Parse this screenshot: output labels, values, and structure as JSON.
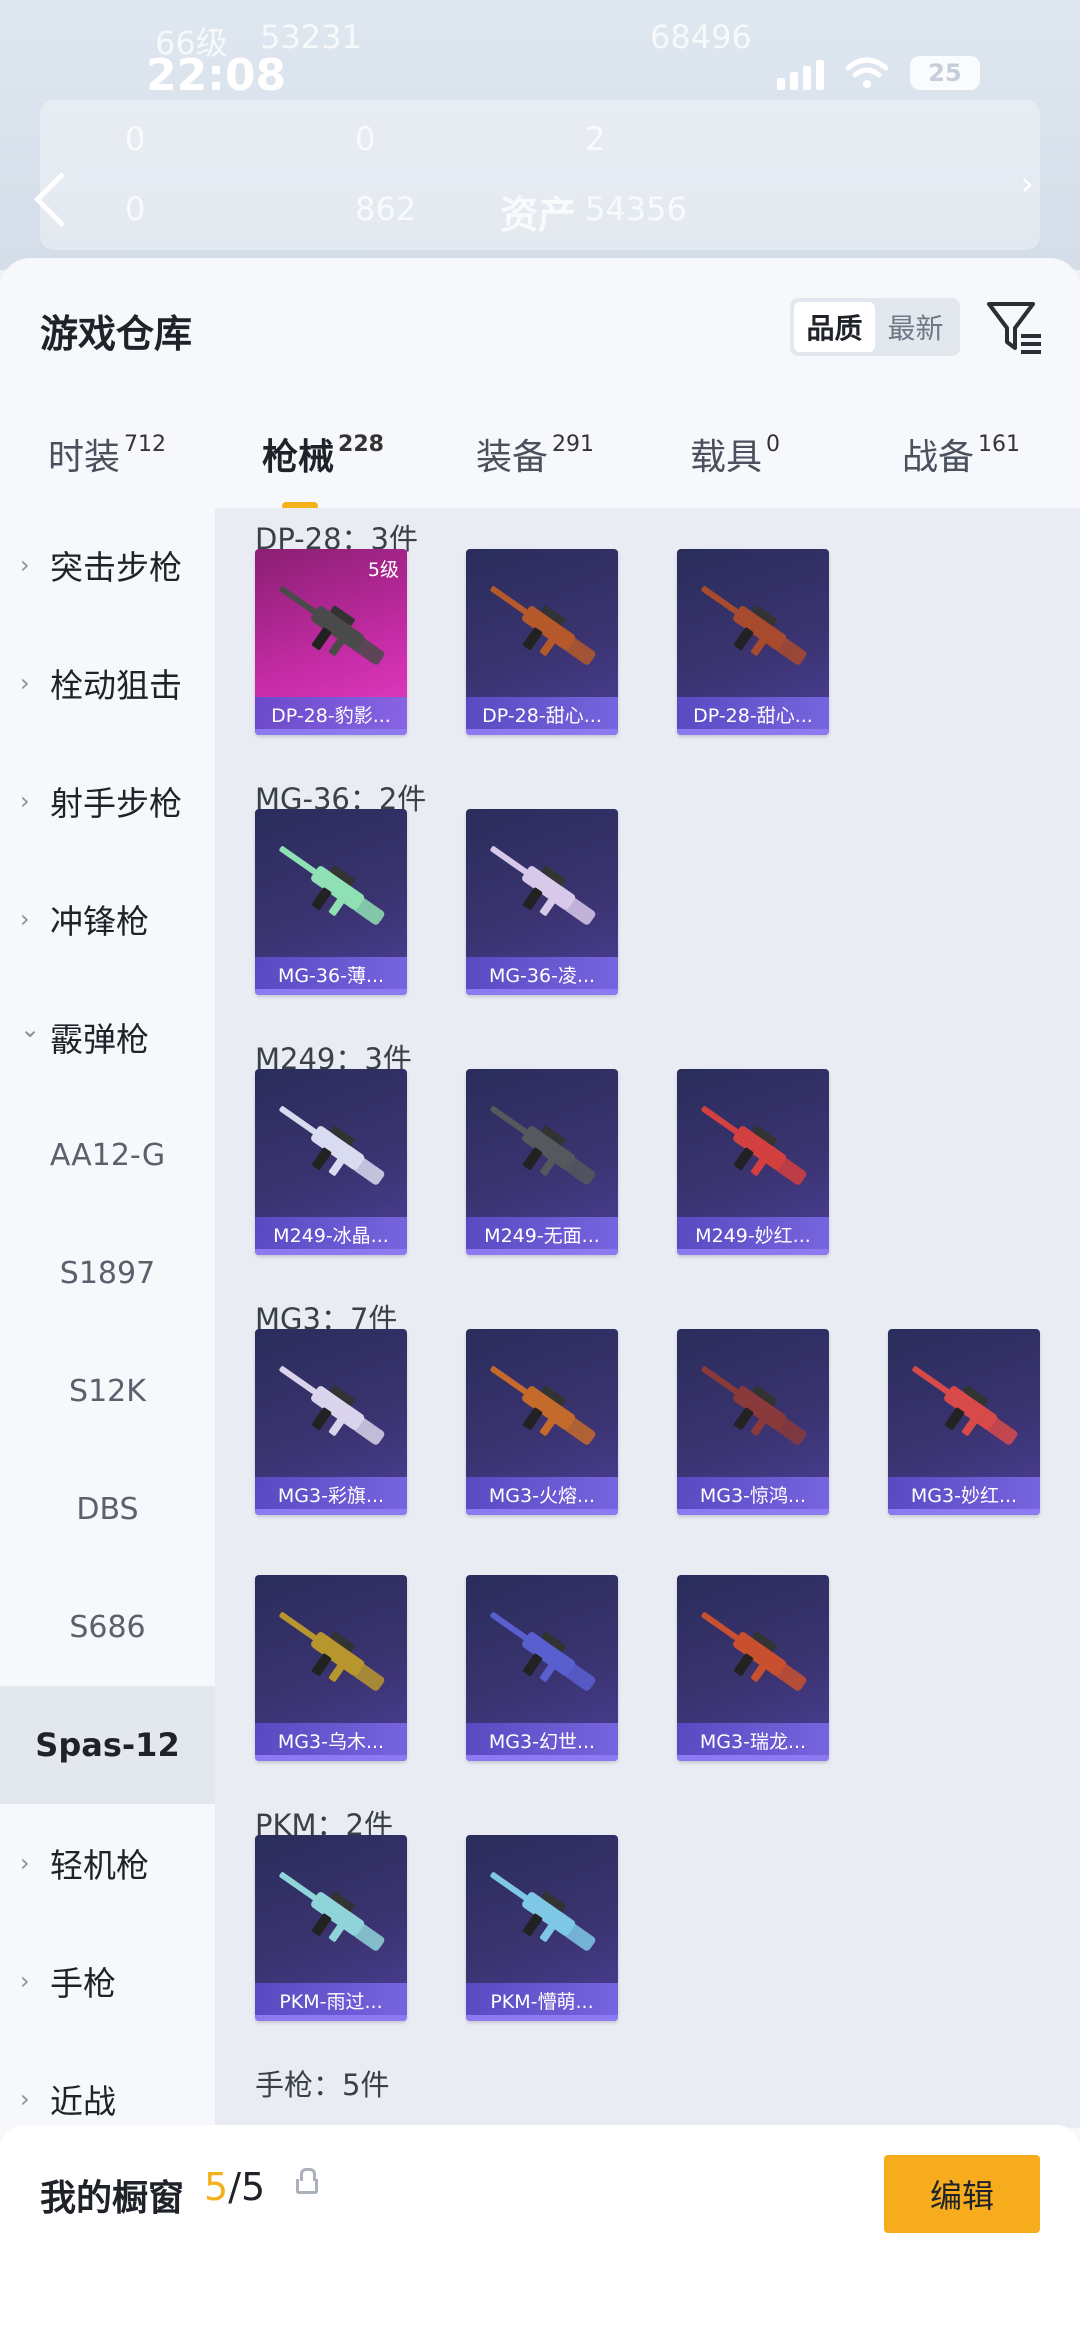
{
  "status_bar": {
    "time": "22:08",
    "battery": "25"
  },
  "backdrop": {
    "level": "66级",
    "coins": "53231",
    "score": "68496",
    "stat_1": "0",
    "stat_2": "0",
    "stat_3": "2",
    "stat_4": "0",
    "stat_5": "862",
    "assets_label": "资产",
    "assets_value": "54356"
  },
  "warehouse": {
    "title": "游戏仓库",
    "sort_options": [
      "品质",
      "最新"
    ],
    "active_sort": "品质"
  },
  "tabs": [
    {
      "label": "时装",
      "count": "712"
    },
    {
      "label": "枪械",
      "count": "228",
      "active": true
    },
    {
      "label": "装备",
      "count": "291"
    },
    {
      "label": "载具",
      "count": "0"
    },
    {
      "label": "战备",
      "count": "161"
    }
  ],
  "categories": [
    {
      "label": "突击步枪",
      "type": "collapsed"
    },
    {
      "label": "栓动狙击",
      "type": "collapsed"
    },
    {
      "label": "射手步枪",
      "type": "collapsed"
    },
    {
      "label": "冲锋枪",
      "type": "collapsed"
    },
    {
      "label": "霰弹枪",
      "type": "expanded"
    },
    {
      "label": "AA12-G",
      "type": "sub"
    },
    {
      "label": "S1897",
      "type": "sub"
    },
    {
      "label": "S12K",
      "type": "sub"
    },
    {
      "label": "DBS",
      "type": "sub"
    },
    {
      "label": "S686",
      "type": "sub"
    },
    {
      "label": "Spas-12",
      "type": "sub",
      "selected": true
    },
    {
      "label": "轻机枪",
      "type": "collapsed"
    },
    {
      "label": "手枪",
      "type": "collapsed"
    },
    {
      "label": "近战",
      "type": "collapsed"
    }
  ],
  "groups": [
    {
      "title": "DP-28：3件",
      "items": [
        {
          "name": "DP-28-豹影...",
          "level": "5级",
          "quality": "pink",
          "color": "#4a4a4a"
        },
        {
          "name": "DP-28-甜心...",
          "color": "#b5582a"
        },
        {
          "name": "DP-28-甜心...",
          "color": "#a84a2e"
        }
      ]
    },
    {
      "title": "MG-36：2件",
      "items": [
        {
          "name": "MG-36-薄...",
          "color": "#8fe0b4"
        },
        {
          "name": "MG-36-凌...",
          "color": "#d8c8ea"
        }
      ]
    },
    {
      "title": "M249：3件",
      "items": [
        {
          "name": "M249-冰晶...",
          "color": "#d9dcf0"
        },
        {
          "name": "M249-无面...",
          "color": "#55585c"
        },
        {
          "name": "M249-妙红...",
          "color": "#d44040"
        }
      ]
    },
    {
      "title": "MG3：7件",
      "items": [
        {
          "name": "MG3-彩旗...",
          "color": "#d9d4ec"
        },
        {
          "name": "MG3-火熔...",
          "color": "#c46a2a"
        },
        {
          "name": "MG3-惊鸿...",
          "color": "#8a3a3a"
        },
        {
          "name": "MG3-妙红...",
          "color": "#d84a4a"
        },
        {
          "name": "MG3-乌木...",
          "color": "#b8962e"
        },
        {
          "name": "MG3-幻世...",
          "color": "#5a5fd0"
        },
        {
          "name": "MG3-瑞龙...",
          "color": "#c8502e"
        }
      ]
    },
    {
      "title": "PKM：2件",
      "items": [
        {
          "name": "PKM-雨过...",
          "color": "#8fd4d8"
        },
        {
          "name": "PKM-懵萌...",
          "color": "#7ec8e6"
        }
      ]
    },
    {
      "title": "手枪：5件",
      "items": []
    }
  ],
  "showcase": {
    "title": "我的橱窗",
    "current": "5",
    "total": "/5",
    "edit_label": "编辑"
  }
}
